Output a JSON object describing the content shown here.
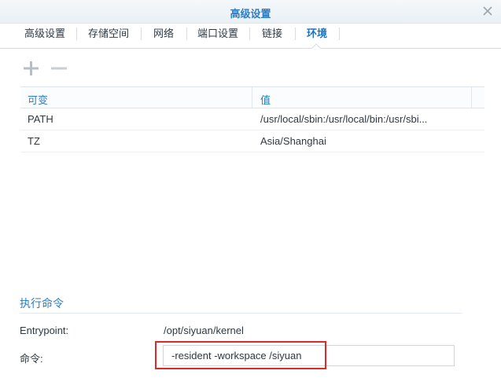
{
  "dialog": {
    "title": "高级设置"
  },
  "tabs": [
    {
      "label": "高级设置",
      "active": false
    },
    {
      "label": "存储空间",
      "active": false
    },
    {
      "label": "网络",
      "active": false
    },
    {
      "label": "端口设置",
      "active": false
    },
    {
      "label": "链接",
      "active": false
    },
    {
      "label": "环境",
      "active": true
    }
  ],
  "toolbar": {
    "add_icon": "plus-icon",
    "remove_icon": "minus-icon"
  },
  "grid": {
    "columns": [
      "可变",
      "值"
    ],
    "rows": [
      {
        "variable": "PATH",
        "value": "/usr/local/sbin:/usr/local/bin:/usr/sbi..."
      },
      {
        "variable": "TZ",
        "value": "Asia/Shanghai"
      }
    ]
  },
  "execution": {
    "section_title": "执行命令",
    "entrypoint_label": "Entrypoint:",
    "entrypoint_value": "/opt/siyuan/kernel",
    "command_label": "命令:",
    "command_value": "-resident -workspace /siyuan"
  },
  "colors": {
    "accent": "#2d7dc6",
    "highlight": "#e0282b"
  }
}
